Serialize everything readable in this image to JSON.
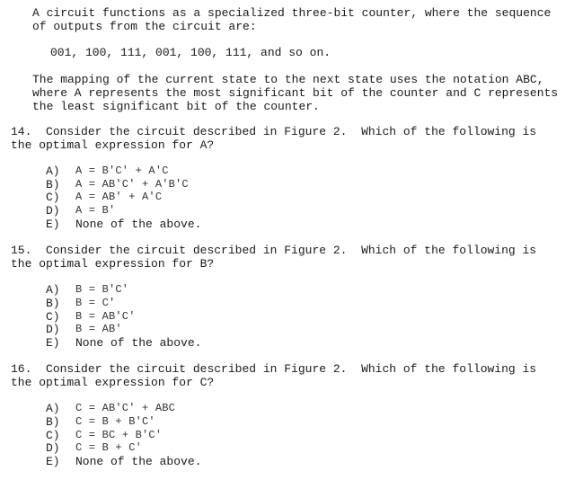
{
  "intro": {
    "paragraph1": [
      "A circuit functions as a specialized three-bit counter, where the sequence",
      "of outputs from the circuit are:"
    ],
    "sequence": "001, 100, 111, 001, 100, 111, and so on.",
    "paragraph2": [
      "The mapping of the current state to the next state uses the notation ABC,",
      "where A represents the most significant bit of the counter and C represents",
      "the least significant bit of the counter."
    ]
  },
  "questions": [
    {
      "number": "14.",
      "stem": [
        "Consider the circuit described in Figure 2.  Which of the following is",
        "the optimal expression for A?"
      ],
      "options": [
        {
          "label": "A)",
          "text": "A = B′C′ + A′C"
        },
        {
          "label": "B)",
          "text": "A = AB′C′ + A′B′C"
        },
        {
          "label": "C)",
          "text": "A = AB′ + A′C"
        },
        {
          "label": "D)",
          "text": "A = B′"
        },
        {
          "label": "E)",
          "text": "None of the above."
        }
      ]
    },
    {
      "number": "15.",
      "stem": [
        "Consider the circuit described in Figure 2.  Which of the following is",
        "the optimal expression for B?"
      ],
      "options": [
        {
          "label": "A)",
          "text": "B = B′C′"
        },
        {
          "label": "B)",
          "text": "B = C′"
        },
        {
          "label": "C)",
          "text": "B = AB′C′"
        },
        {
          "label": "D)",
          "text": "B = AB′"
        },
        {
          "label": "E)",
          "text": "None of the above."
        }
      ]
    },
    {
      "number": "16.",
      "stem": [
        "Consider the circuit described in Figure 2.  Which of the following is",
        "the optimal expression for C?"
      ],
      "options": [
        {
          "label": "A)",
          "text": "C = AB′C′ + ABC"
        },
        {
          "label": "B)",
          "text": "C = B + B′C′"
        },
        {
          "label": "C)",
          "text": "C = BC + B′C′"
        },
        {
          "label": "D)",
          "text": "C = B + C′"
        },
        {
          "label": "E)",
          "text": "None of the above."
        }
      ]
    }
  ]
}
